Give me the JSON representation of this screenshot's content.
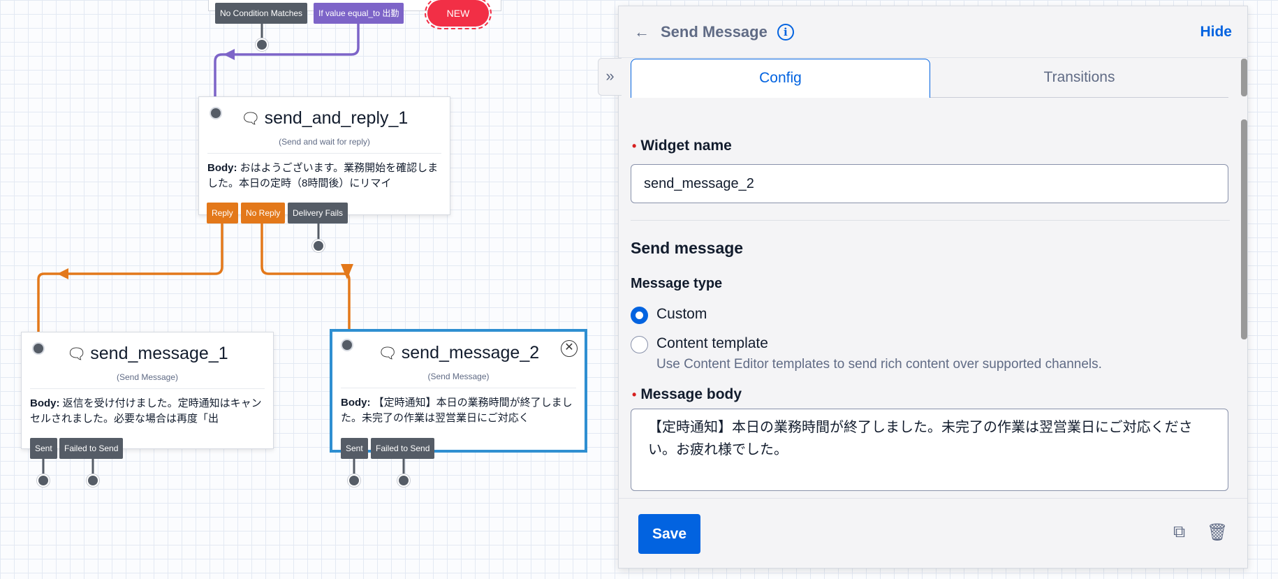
{
  "canvas": {
    "top_conditions": [
      "No Condition Matches",
      "If value equal_to 出勤"
    ],
    "new_badge": "NEW",
    "nodes": [
      {
        "id": "send_and_reply_1",
        "title": "send_and_reply_1",
        "subtitle": "(Send and wait for reply)",
        "body_label": "Body:",
        "body_text": "おはようございます。業務開始を確認しました。本日の定時（8時間後）にリマイ",
        "transitions": [
          "Reply",
          "No Reply",
          "Delivery Fails"
        ]
      },
      {
        "id": "send_message_1",
        "title": "send_message_1",
        "subtitle": "(Send Message)",
        "body_label": "Body:",
        "body_text": "返信を受け付けました。定時通知はキャンセルされました。必要な場合は再度「出",
        "transitions": [
          "Sent",
          "Failed to Send"
        ]
      },
      {
        "id": "send_message_2",
        "title": "send_message_2",
        "subtitle": "(Send Message)",
        "body_label": "Body:",
        "body_text": "【定時通知】本日の業務時間が終了しました。未完了の作業は翌営業日にご対応く",
        "transitions": [
          "Sent",
          "Failed to Send"
        ]
      }
    ],
    "colors": {
      "purple": "#7d64c8",
      "orange": "#e3781a",
      "dark": "#555c66",
      "selected": "#2f8fd1",
      "new": "#f22f46"
    }
  },
  "panel": {
    "back_icon": "arrow-left-icon",
    "title": "Send Message",
    "info_icon": "info-icon",
    "hide_label": "Hide",
    "collapse_icon": "double-chevron-right-icon",
    "tabs": [
      "Config",
      "Transitions"
    ],
    "active_tab": "Config",
    "widget_name_label": "Widget name",
    "widget_name_value": "send_message_2",
    "section_title": "Send message",
    "message_type_label": "Message type",
    "options": [
      {
        "label": "Custom",
        "checked": true
      },
      {
        "label": "Content template",
        "help": "Use Content Editor templates to send rich content over supported channels.",
        "checked": false
      }
    ],
    "message_body_label": "Message body",
    "message_body_value": "【定時通知】本日の業務時間が終了しました。未完了の作業は翌営業日にご対応ください。お疲れ様でした。",
    "save_label": "Save",
    "duplicate_icon": "duplicate-icon",
    "delete_icon": "trash-icon",
    "accent": "#0263e0"
  }
}
